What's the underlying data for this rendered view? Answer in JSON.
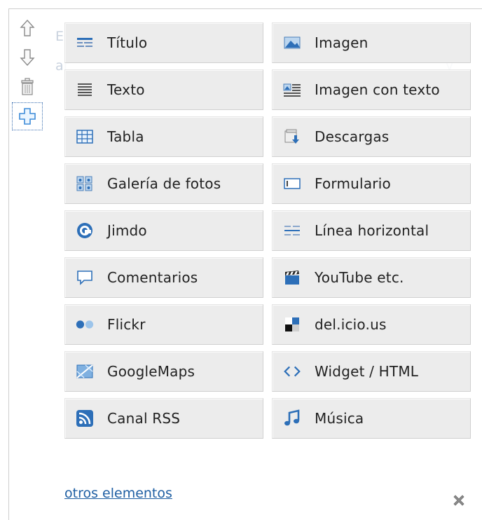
{
  "toolbar": {
    "tools": [
      {
        "icon": "arrow-up-icon"
      },
      {
        "icon": "arrow-down-icon"
      },
      {
        "icon": "trash-icon"
      },
      {
        "icon": "add-plus-icon"
      }
    ]
  },
  "elements": [
    {
      "label": "Título",
      "icon": "title-icon"
    },
    {
      "label": "Imagen",
      "icon": "image-icon"
    },
    {
      "label": "Texto",
      "icon": "text-icon"
    },
    {
      "label": "Imagen con texto",
      "icon": "image-with-text-icon"
    },
    {
      "label": "Tabla",
      "icon": "table-icon"
    },
    {
      "label": "Descargas",
      "icon": "downloads-icon"
    },
    {
      "label": "Galería de fotos",
      "icon": "photo-gallery-icon"
    },
    {
      "label": "Formulario",
      "icon": "form-icon"
    },
    {
      "label": "Jimdo",
      "icon": "jimdo-icon"
    },
    {
      "label": "Línea horizontal",
      "icon": "horizontal-line-icon"
    },
    {
      "label": "Comentarios",
      "icon": "comments-icon"
    },
    {
      "label": "YouTube etc.",
      "icon": "video-clapper-icon"
    },
    {
      "label": "Flickr",
      "icon": "flickr-icon"
    },
    {
      "label": "del.icio.us",
      "icon": "delicious-icon"
    },
    {
      "label": "GoogleMaps",
      "icon": "map-icon"
    },
    {
      "label": "Widget / HTML",
      "icon": "code-icon"
    },
    {
      "label": "Canal RSS",
      "icon": "rss-icon"
    },
    {
      "label": "Música",
      "icon": "music-icon"
    }
  ],
  "footer": {
    "link": "otros elementos",
    "close_icon": "close-icon"
  }
}
